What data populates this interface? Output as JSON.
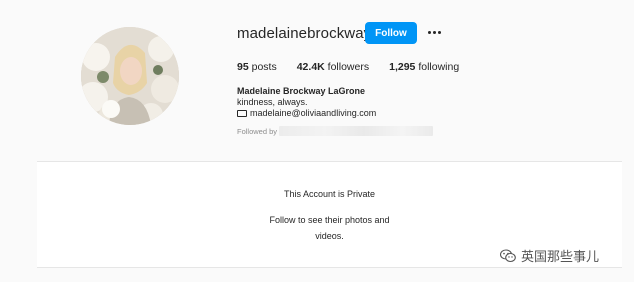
{
  "profile": {
    "username": "madelainebrockway",
    "follow_label": "Follow",
    "posts_count": "95",
    "posts_label": "posts",
    "followers_count": "42.4K",
    "followers_label": "followers",
    "following_count": "1,295",
    "following_label": "following",
    "full_name": "Madelaine Brockway LaGrone",
    "bio": "kindness, always.",
    "email": "madelaine@oliviaandliving.com",
    "followed_by_label": "Followed by"
  },
  "private": {
    "title": "This Account is Private",
    "subtitle": "Follow to see their photos and videos."
  },
  "watermark": {
    "text": "英国那些事儿"
  },
  "colors": {
    "follow_button": "#0095f6",
    "background": "#fafafa"
  },
  "icons": {
    "more": "more-options-icon",
    "email": "mail-icon",
    "watermark": "wechat-icon"
  }
}
